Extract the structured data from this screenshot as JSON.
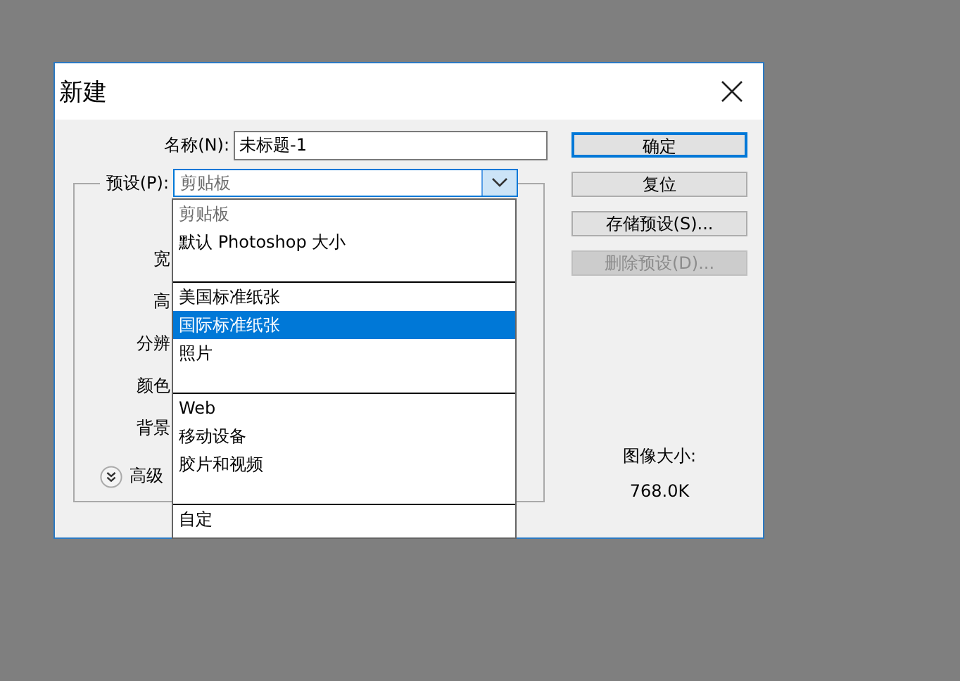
{
  "window": {
    "title": "新建"
  },
  "name_field": {
    "label": "名称(N):",
    "value": "未标题-1"
  },
  "preset": {
    "label": "预设(P):",
    "value": "剪贴板",
    "open": true
  },
  "preset_options": [
    {
      "kind": "item",
      "label": "剪贴板",
      "grayed": true,
      "selected": false
    },
    {
      "kind": "item",
      "label": "默认 Photoshop 大小",
      "grayed": false,
      "selected": false
    },
    {
      "kind": "separator"
    },
    {
      "kind": "item",
      "label": "美国标准纸张",
      "grayed": false,
      "selected": false
    },
    {
      "kind": "item",
      "label": "国际标准纸张",
      "grayed": false,
      "selected": true
    },
    {
      "kind": "item",
      "label": "照片",
      "grayed": false,
      "selected": false
    },
    {
      "kind": "separator"
    },
    {
      "kind": "item",
      "label": "Web",
      "grayed": false,
      "selected": false
    },
    {
      "kind": "item",
      "label": "移动设备",
      "grayed": false,
      "selected": false
    },
    {
      "kind": "item",
      "label": "胶片和视频",
      "grayed": false,
      "selected": false
    },
    {
      "kind": "separator"
    },
    {
      "kind": "item",
      "label": "自定",
      "grayed": false,
      "selected": false
    }
  ],
  "group_labels": [
    "宽",
    "高",
    "分辨",
    "颜色",
    "背景"
  ],
  "advanced": {
    "label": "高级"
  },
  "buttons": [
    {
      "label": "确定",
      "default": true,
      "disabled": false
    },
    {
      "label": "复位",
      "default": false,
      "disabled": false
    },
    {
      "label": "存储预设(S)...",
      "default": false,
      "disabled": false
    },
    {
      "label": "删除预设(D)...",
      "default": false,
      "disabled": true
    }
  ],
  "image_size": {
    "label": "图像大小:",
    "value": "768.0K"
  }
}
